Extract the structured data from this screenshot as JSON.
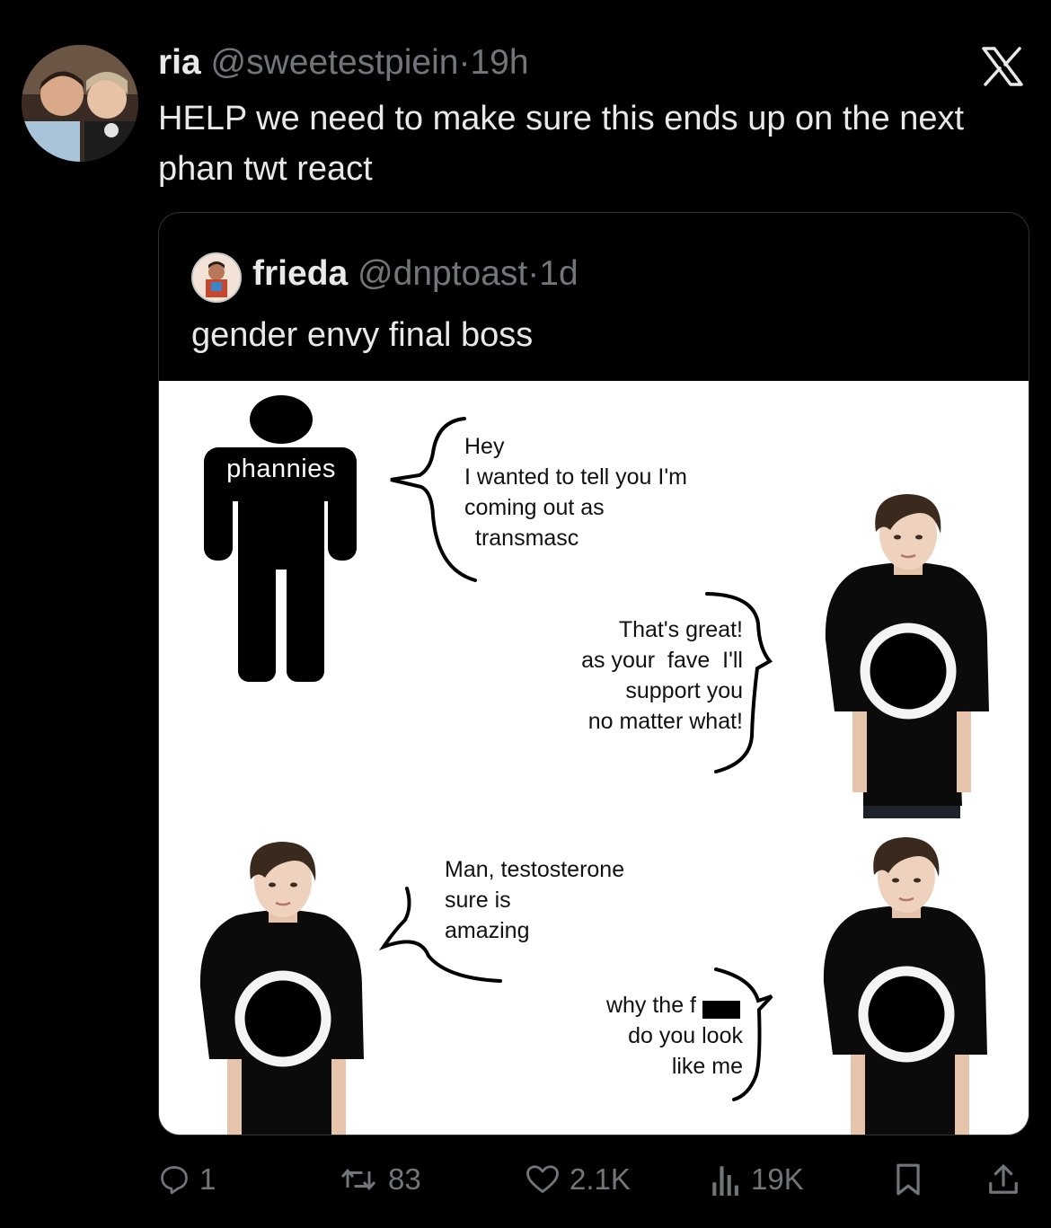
{
  "tweet": {
    "author_name": "ria",
    "author_handle": "@sweetestpiein",
    "separator": "·",
    "time": "19h",
    "text": "HELP we need to make sure this ends up on the next phan twt react"
  },
  "quoted_tweet": {
    "author_name": "frieda",
    "author_handle": "@dnptoast",
    "separator": "·",
    "time": "1d",
    "text": "gender envy final boss"
  },
  "meme": {
    "figure_label": "phannies",
    "bubble1": [
      "Hey",
      "I wanted to tell you I'm",
      "coming out as",
      "transmasc"
    ],
    "bubble2": [
      "That's great!",
      "as your  fave  I'll",
      "support you",
      "no matter what!"
    ],
    "bubble3": [
      "Man, testosterone",
      "sure is",
      "amazing"
    ],
    "bubble4": [
      "why the f",
      "do you look",
      "like me"
    ]
  },
  "actions": {
    "replies": "1",
    "reposts": "83",
    "likes": "2.1K",
    "views": "19K"
  },
  "icons": [
    "x-logo-icon",
    "reply-icon",
    "repost-icon",
    "like-icon",
    "views-icon",
    "bookmark-icon",
    "share-icon"
  ]
}
